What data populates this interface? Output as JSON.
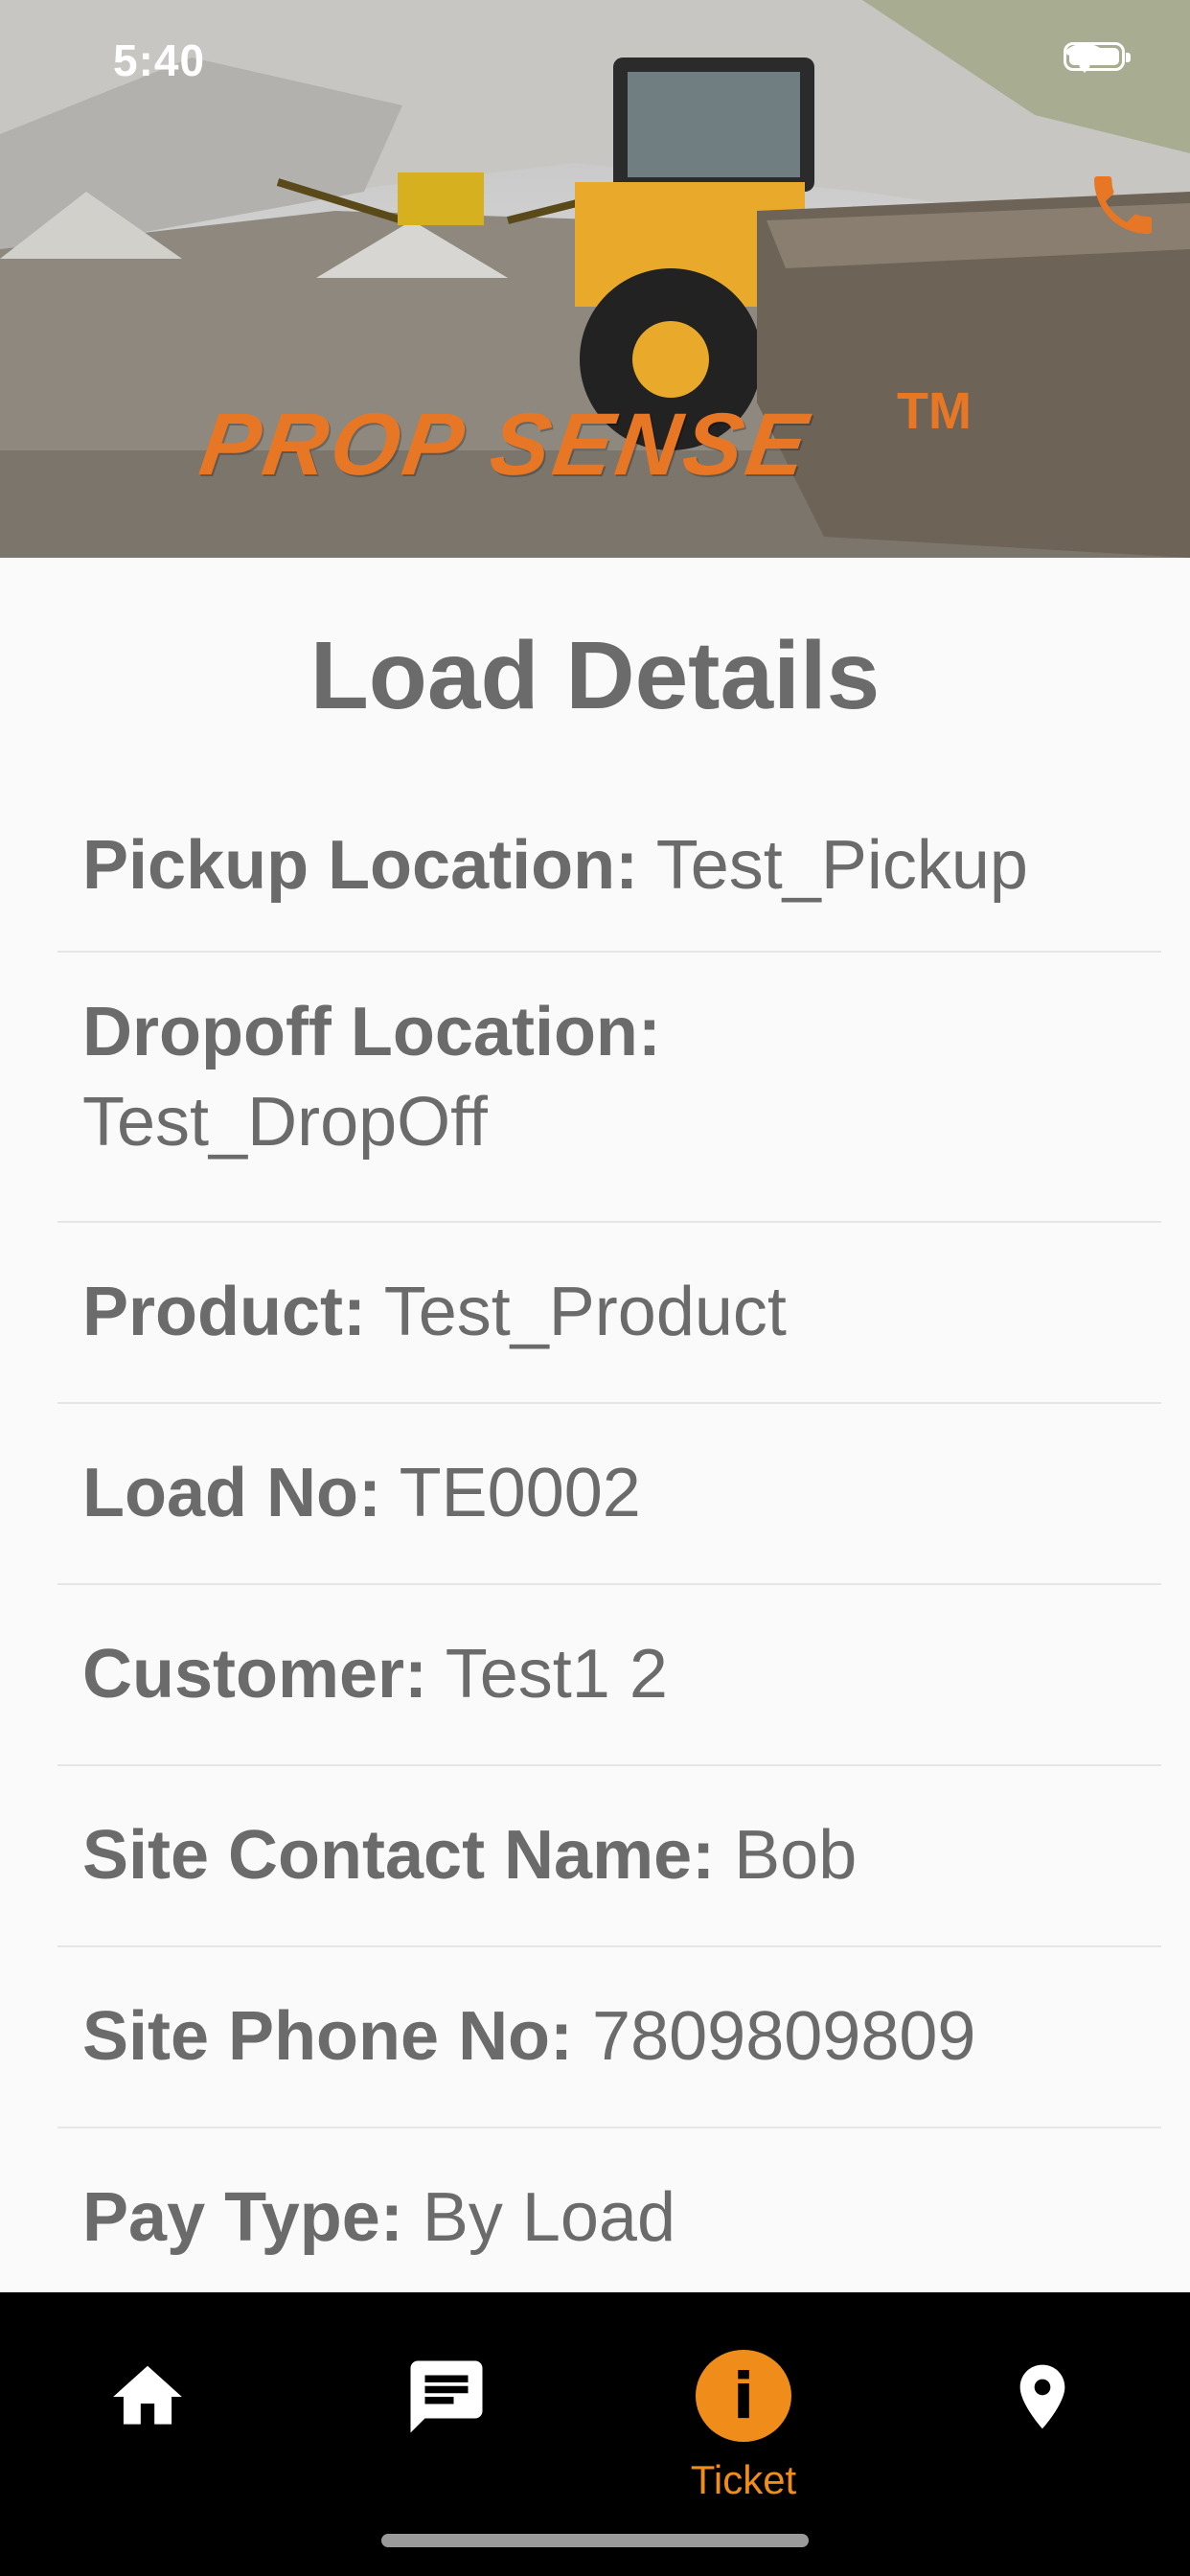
{
  "status_bar": {
    "time": "5:40",
    "icons": [
      "wifi-icon",
      "battery-icon"
    ]
  },
  "header": {
    "brand": "PROP SENSE",
    "brand_tm": "TM",
    "brand_color": "#e87725",
    "phone_icon": "phone-icon"
  },
  "page": {
    "title": "Load Details"
  },
  "details": [
    {
      "label": "Pickup Location:",
      "value": "Test_Pickup"
    },
    {
      "label": "Dropoff Location:",
      "value": "Test_DropOff"
    },
    {
      "label": "Product:",
      "value": "Test_Product"
    },
    {
      "label": "Load No:",
      "value": "TE0002"
    },
    {
      "label": "Customer:",
      "value": "Test1 2"
    },
    {
      "label": "Site Contact Name:",
      "value": "Bob"
    },
    {
      "label": "Site Phone No:",
      "value": "7809809809"
    },
    {
      "label": "Pay Type:",
      "value": "By Load"
    }
  ],
  "bottom_nav": {
    "items": [
      {
        "icon": "home-icon"
      },
      {
        "icon": "chat-icon"
      },
      {
        "icon": "info-icon",
        "label": "Ticket",
        "active": true
      },
      {
        "icon": "location-pin-icon"
      }
    ],
    "active_color": "#f08c1a"
  }
}
